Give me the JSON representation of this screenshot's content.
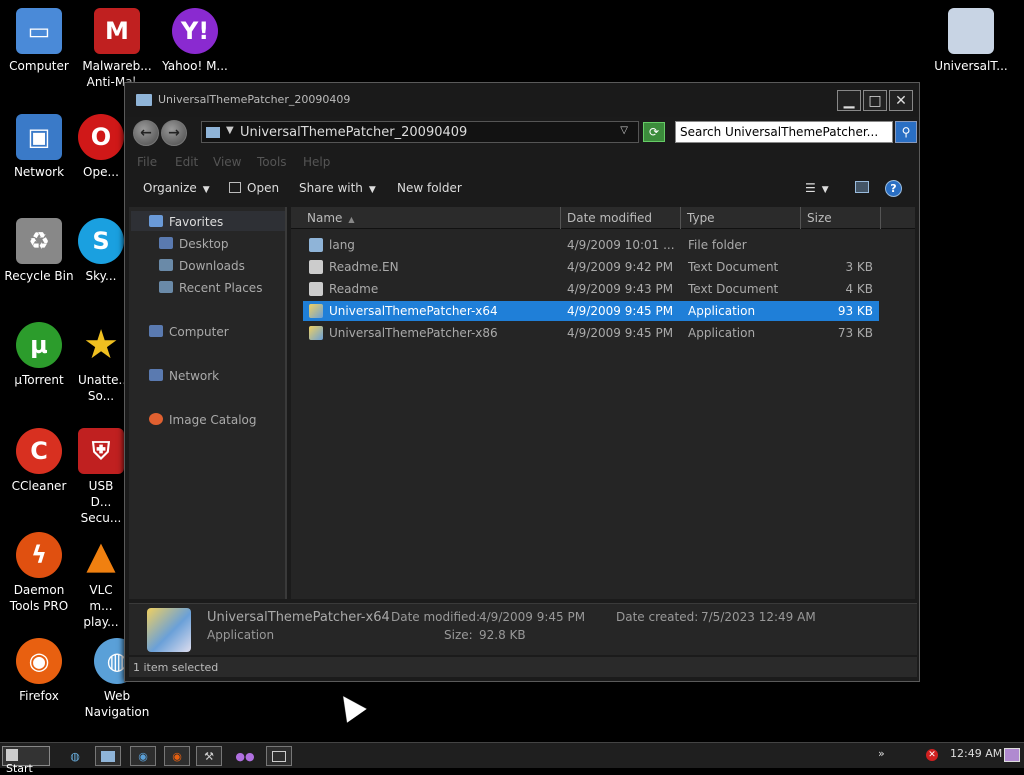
{
  "desktop_icons": [
    {
      "label": "Computer",
      "icon": "computer-icon",
      "color": "#4a8ad8"
    },
    {
      "label": "Malwareb... Anti-Mal...",
      "icon": "malwarebytes-icon",
      "color": "#c02020"
    },
    {
      "label": "Yahoo! M...",
      "icon": "yahoo-messenger-icon",
      "color": "#8a2ad0"
    },
    {
      "label": "UniversalT...",
      "icon": "folder-icon",
      "color": "#c8d4e4"
    },
    {
      "label": "Network",
      "icon": "network-icon",
      "color": "#3a7ac8"
    },
    {
      "label": "Ope...",
      "icon": "opera-icon",
      "color": "#d01818"
    },
    {
      "label": "Recycle Bin",
      "icon": "recycle-bin-icon",
      "color": "#888888"
    },
    {
      "label": "Sky...",
      "icon": "skype-icon",
      "color": "#1aa0e0"
    },
    {
      "label": "µTorrent",
      "icon": "utorrent-icon",
      "color": "#2c9c2c"
    },
    {
      "label": "Unatte... So...",
      "icon": "star-icon",
      "color": "#f0c020"
    },
    {
      "label": "CCleaner",
      "icon": "ccleaner-icon",
      "color": "#d83020"
    },
    {
      "label": "USB D... Secu...",
      "icon": "usb-security-icon",
      "color": "#c02020"
    },
    {
      "label": "Daemon Tools PRO",
      "icon": "daemon-tools-icon",
      "color": "#e05010"
    },
    {
      "label": "VLC m... play...",
      "icon": "vlc-icon",
      "color": "#f08010"
    },
    {
      "label": "Firefox",
      "icon": "firefox-icon",
      "color": "#e86010"
    },
    {
      "label": "Web Navigation",
      "icon": "globe-icon",
      "color": "#5aa0d8"
    }
  ],
  "window": {
    "title": "UniversalThemePatcher_20090409",
    "address_path": "UniversalThemePatcher_20090409",
    "search_placeholder": "Search UniversalThemePatcher...",
    "menu": [
      "File",
      "Edit",
      "View",
      "Tools",
      "Help"
    ],
    "toolbar": {
      "organize": "Organize",
      "open": "Open",
      "share_with": "Share with",
      "new_folder": "New folder"
    },
    "nav": {
      "favorites": "Favorites",
      "desktop": "Desktop",
      "downloads": "Downloads",
      "recent_places": "Recent Places",
      "computer": "Computer",
      "network": "Network",
      "image_catalog": "Image Catalog"
    },
    "columns": {
      "name": "Name",
      "date_modified": "Date modified",
      "type": "Type",
      "size": "Size"
    },
    "files": [
      {
        "name": "lang",
        "date": "4/9/2009 10:01 ...",
        "type": "File folder",
        "size": "",
        "icon": "folder-icon",
        "selected": false
      },
      {
        "name": "Readme.EN",
        "date": "4/9/2009 9:42 PM",
        "type": "Text Document",
        "size": "3 KB",
        "icon": "text-document-icon",
        "selected": false
      },
      {
        "name": "Readme",
        "date": "4/9/2009 9:43 PM",
        "type": "Text Document",
        "size": "4 KB",
        "icon": "text-document-icon",
        "selected": false
      },
      {
        "name": "UniversalThemePatcher-x64",
        "date": "4/9/2009 9:45 PM",
        "type": "Application",
        "size": "93 KB",
        "icon": "application-icon",
        "selected": true
      },
      {
        "name": "UniversalThemePatcher-x86",
        "date": "4/9/2009 9:45 PM",
        "type": "Application",
        "size": "73 KB",
        "icon": "application-icon",
        "selected": false
      }
    ],
    "details": {
      "name": "UniversalThemePatcher-x64",
      "type": "Application",
      "date_modified_label": "Date modified:",
      "date_modified": "4/9/2009 9:45 PM",
      "size_label": "Size:",
      "size": "92.8 KB",
      "date_created_label": "Date created:",
      "date_created": "7/5/2023 12:49 AM"
    },
    "status": "1 item selected"
  },
  "taskbar": {
    "start_label": "Start",
    "clock": "12:49 AM",
    "show_hidden": "»"
  },
  "colors": {
    "selection": "#1f7fd8",
    "window_bg": "#1b1b1b",
    "pane_bg": "#262626"
  }
}
